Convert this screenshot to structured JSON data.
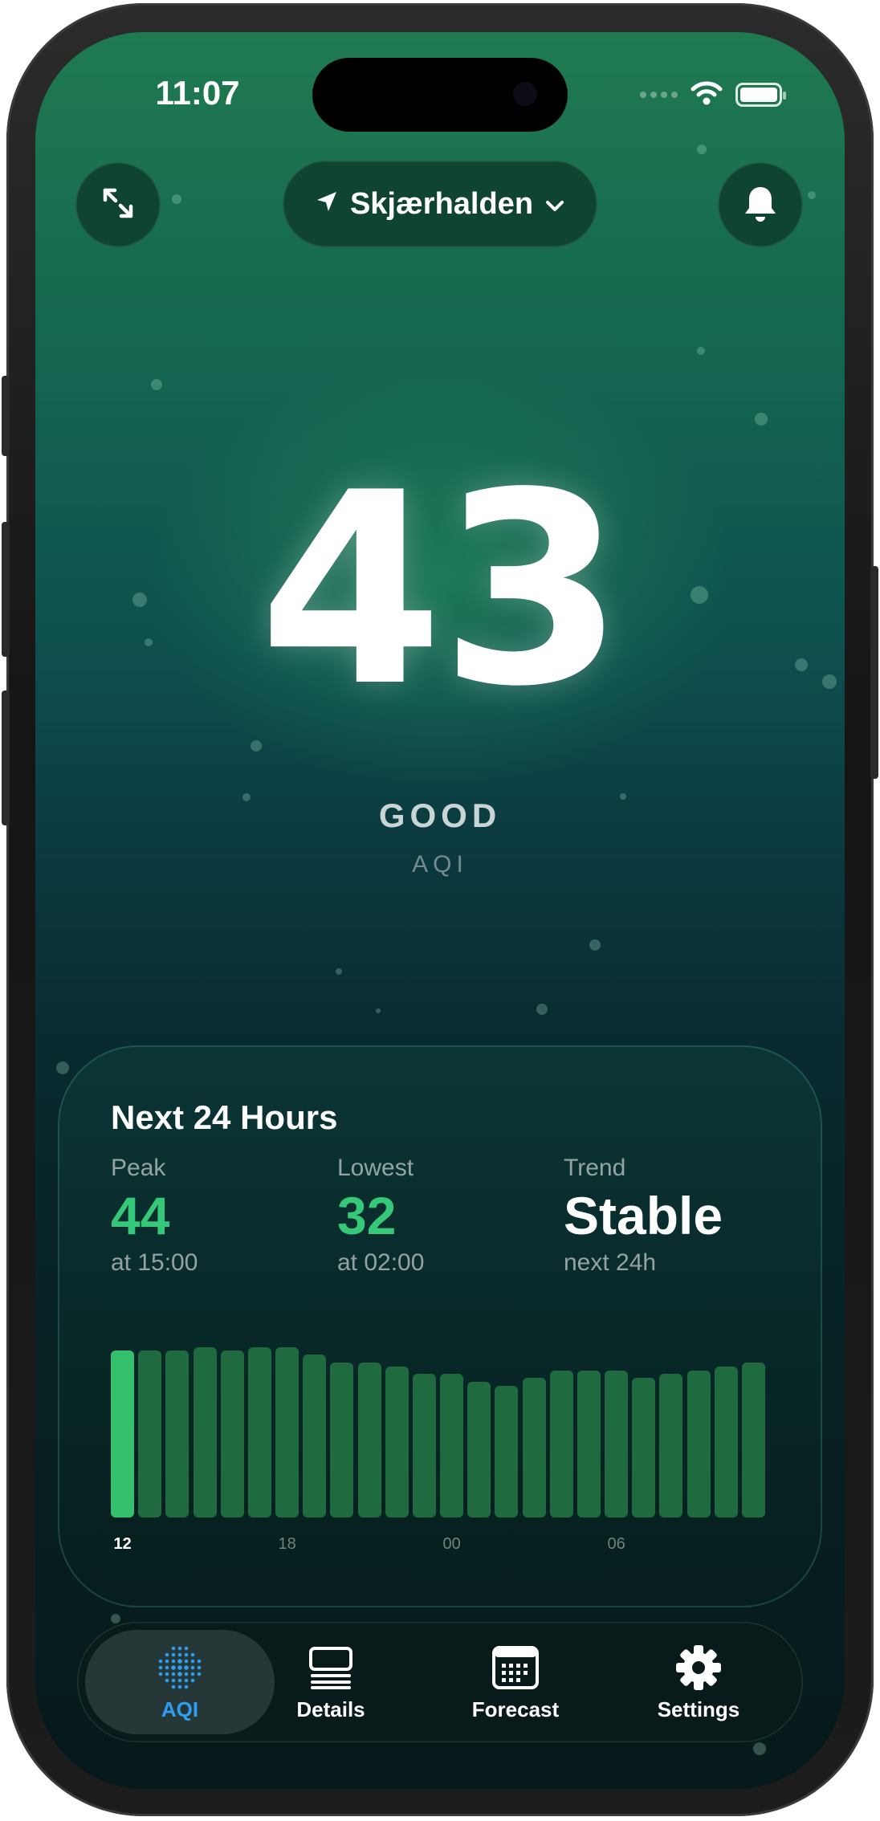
{
  "status_bar": {
    "time": "11:07"
  },
  "header": {
    "location_name": "Skjærhalden",
    "expand_icon": "expand-arrows-icon",
    "location_icon": "location-arrow-icon",
    "chevron_icon": "chevron-down-icon",
    "bell_icon": "bell-icon"
  },
  "aqi": {
    "value": "43",
    "category": "GOOD",
    "unit": "AQI"
  },
  "forecast_card": {
    "title": "Next 24 Hours",
    "peak": {
      "label": "Peak",
      "value": "44",
      "time": "at 15:00"
    },
    "lowest": {
      "label": "Lowest",
      "value": "32",
      "time": "at 02:00"
    },
    "trend": {
      "label": "Trend",
      "value": "Stable",
      "sub": "next 24h"
    }
  },
  "chart_data": {
    "type": "bar",
    "x_tick_labels": [
      "12",
      "18",
      "00",
      "06"
    ],
    "values": [
      43,
      43,
      43,
      44,
      43,
      44,
      44,
      42,
      40,
      40,
      39,
      37,
      37,
      35,
      34,
      36,
      38,
      38,
      38,
      36,
      37,
      38,
      39,
      40
    ],
    "highlight_index": 0,
    "highlight_color": "#35c06e",
    "bar_color": "#1f6a3f",
    "ylim": [
      0,
      46
    ]
  },
  "tabbar": {
    "tabs": [
      {
        "label": "AQI",
        "icon": "aqi-dots-icon",
        "active": true
      },
      {
        "label": "Details",
        "icon": "details-list-icon",
        "active": false
      },
      {
        "label": "Forecast",
        "icon": "calendar-icon",
        "active": false
      },
      {
        "label": "Settings",
        "icon": "gear-icon",
        "active": false
      }
    ]
  },
  "colors": {
    "accent_green": "#35c878",
    "active_tab": "#2f9df2",
    "background_top": "#1f7a50",
    "background_bottom": "#06191b"
  }
}
